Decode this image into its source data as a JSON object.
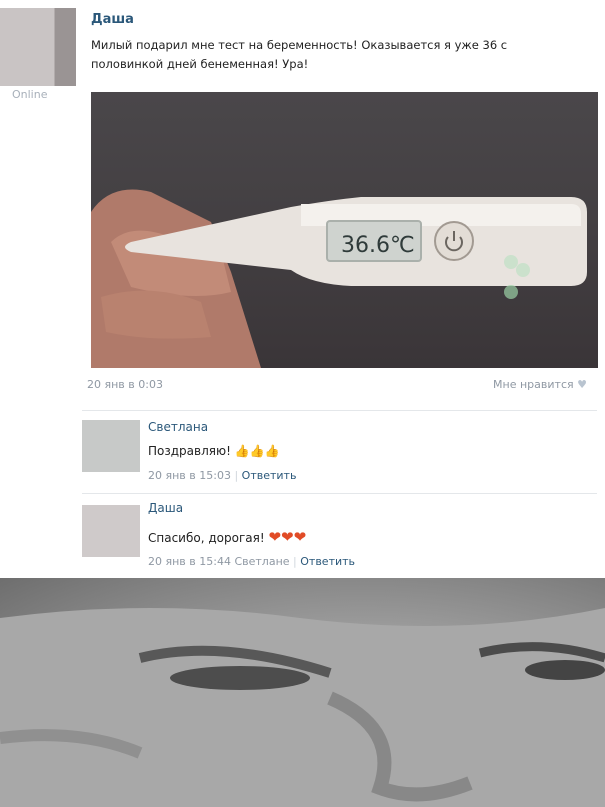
{
  "post": {
    "online": "Online",
    "author": "Даша",
    "text": "Милый подарил мне тест на беременность! Оказывается я уже 36 с половинкой дней бенеменная! Ура!",
    "thermometer_reading": "36.6℃",
    "timestamp": "20 янв в 0:03",
    "like_label": "Мне нравится"
  },
  "comments": [
    {
      "name": "Светлана",
      "text": "Поздравляю!",
      "meta": "20 янв в 15:03",
      "reply": "Ответить",
      "reply_to": ""
    },
    {
      "name": "Даша",
      "text": "Спасибо, дорогая!",
      "meta": "20 янв в 15:44",
      "reply_to": "Светлане",
      "reply": "Ответить"
    }
  ],
  "colors": {
    "link": "#2b587a",
    "muted": "#8f98a3"
  }
}
